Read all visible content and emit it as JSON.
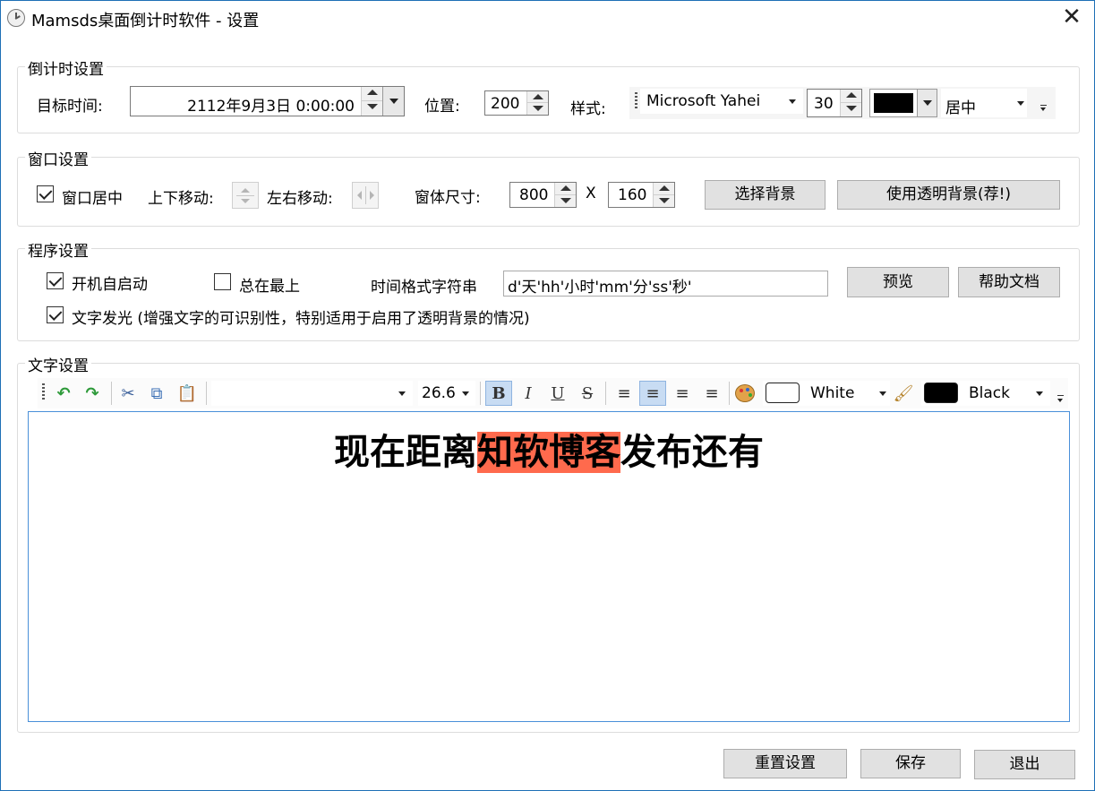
{
  "window": {
    "title": "Mamsds桌面倒计时软件 - 设置"
  },
  "countdown": {
    "group_title": "倒计时设置",
    "target_label": "目标时间:",
    "target_value": "2112年9月3日 0:00:00",
    "position_label": "位置:",
    "position_value": "200",
    "style_label": "样式:",
    "font_value": "Microsoft Yahei",
    "size_value": "30",
    "color_value": "#000000",
    "align_value": "居中"
  },
  "window_settings": {
    "group_title": "窗口设置",
    "center_label": "窗口居中",
    "center_checked": true,
    "vmove_label": "上下移动:",
    "hmove_label": "左右移动:",
    "size_label": "窗体尺寸:",
    "width_value": "800",
    "x_label": "X",
    "height_value": "160",
    "choose_bg_button": "选择背景",
    "transparent_bg_button": "使用透明背景(荐!)"
  },
  "program": {
    "group_title": "程序设置",
    "autostart_label": "开机自启动",
    "autostart_checked": true,
    "topmost_label": "总在最上",
    "topmost_checked": false,
    "format_label": "时间格式字符串",
    "format_value": "d'天'hh'小时'mm'分'ss'秒'",
    "preview_button": "预览",
    "help_button": "帮助文档",
    "glow_label": "文字发光 (增强文字的可识别性，特别适用于启用了透明背景的情况)",
    "glow_checked": true
  },
  "text_settings": {
    "group_title": "文字设置",
    "font_size_value": "26.6",
    "fore_color_name": "White",
    "fore_color": "#ffffff",
    "back_color_name": "Black",
    "back_color": "#000000",
    "highlight_color": "#ff6a4d",
    "editor_before": "现在距离",
    "editor_highlight": "知软博客",
    "editor_after": "发布还有"
  },
  "footer": {
    "reset_button": "重置设置",
    "save_button": "保存",
    "exit_button": "退出"
  }
}
